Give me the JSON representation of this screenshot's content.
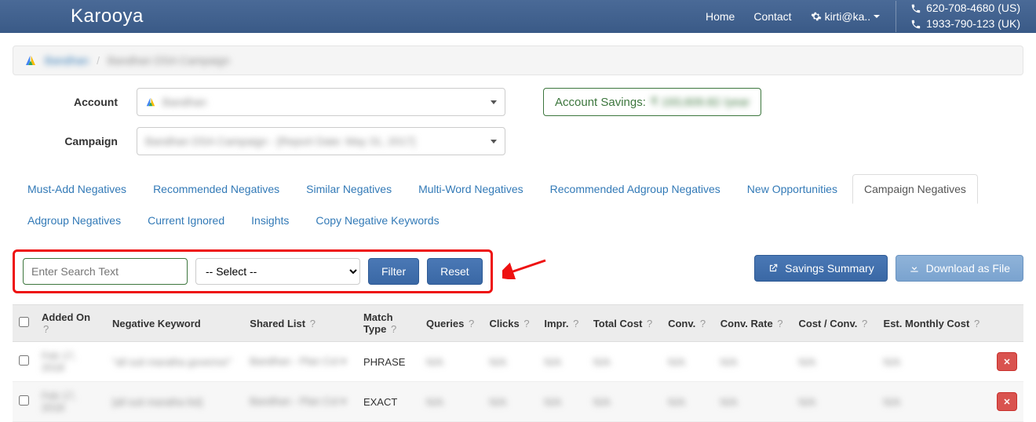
{
  "navbar": {
    "brand": "Karooya",
    "links": {
      "home": "Home",
      "contact": "Contact"
    },
    "user": "kirti@ka..",
    "phones": {
      "us": "620-708-4680 (US)",
      "uk": "1933-790-123 (UK)"
    }
  },
  "breadcrumb": {
    "link_blur": "Bandhan",
    "current_blur": "Bandhan DSA Campaign"
  },
  "form": {
    "account_label": "Account",
    "account_value_blur": "Bandhan",
    "campaign_label": "Campaign",
    "campaign_value_blur": "Bandhan DSA Campaign - [Report Date: May 31, 2017]",
    "savings_label": "Account Savings:",
    "savings_value_blur": "₹ 193,609.82 /year"
  },
  "tabs": {
    "row1": [
      "Must-Add Negatives",
      "Recommended Negatives",
      "Similar Negatives",
      "Multi-Word Negatives",
      "Recommended Adgroup Negatives",
      "New Opportunities",
      "Campaign Negatives"
    ],
    "row2": [
      "Adgroup Negatives",
      "Current Ignored",
      "Insights",
      "Copy Negative Keywords"
    ],
    "active": "Campaign Negatives"
  },
  "filterbar": {
    "search_placeholder": "Enter Search Text",
    "select_placeholder": "-- Select --",
    "filter": "Filter",
    "reset": "Reset",
    "savings_summary": "Savings Summary",
    "download": "Download as File"
  },
  "table": {
    "headers": {
      "added_on": "Added On",
      "negative_keyword": "Negative Keyword",
      "shared_list": "Shared List",
      "match_type": "Match Type",
      "queries": "Queries",
      "clicks": "Clicks",
      "impr": "Impr.",
      "total_cost": "Total Cost",
      "conv": "Conv.",
      "conv_rate": "Conv. Rate",
      "cost_conv": "Cost / Conv.",
      "est_monthly_cost": "Est. Monthly Cost"
    },
    "rows": [
      {
        "added_on_blur": "Feb 17, 2018",
        "keyword_blur": "\"all suit maratha governor\"",
        "shared_list_blur": "Bandhan - Plan Col ▾",
        "match_type": "PHRASE",
        "queries_blur": "N/A",
        "clicks_blur": "N/A",
        "impr_blur": "N/A",
        "cost_blur": "N/A",
        "conv_blur": "N/A",
        "rate_blur": "N/A",
        "cpc_blur": "N/A",
        "est_blur": "N/A"
      },
      {
        "added_on_blur": "Feb 17, 2018",
        "keyword_blur": "[all suit maratha list]",
        "shared_list_blur": "Bandhan - Plan Col ▾",
        "match_type": "EXACT",
        "queries_blur": "N/A",
        "clicks_blur": "N/A",
        "impr_blur": "N/A",
        "cost_blur": "N/A",
        "conv_blur": "N/A",
        "rate_blur": "N/A",
        "cpc_blur": "N/A",
        "est_blur": "N/A"
      }
    ]
  }
}
